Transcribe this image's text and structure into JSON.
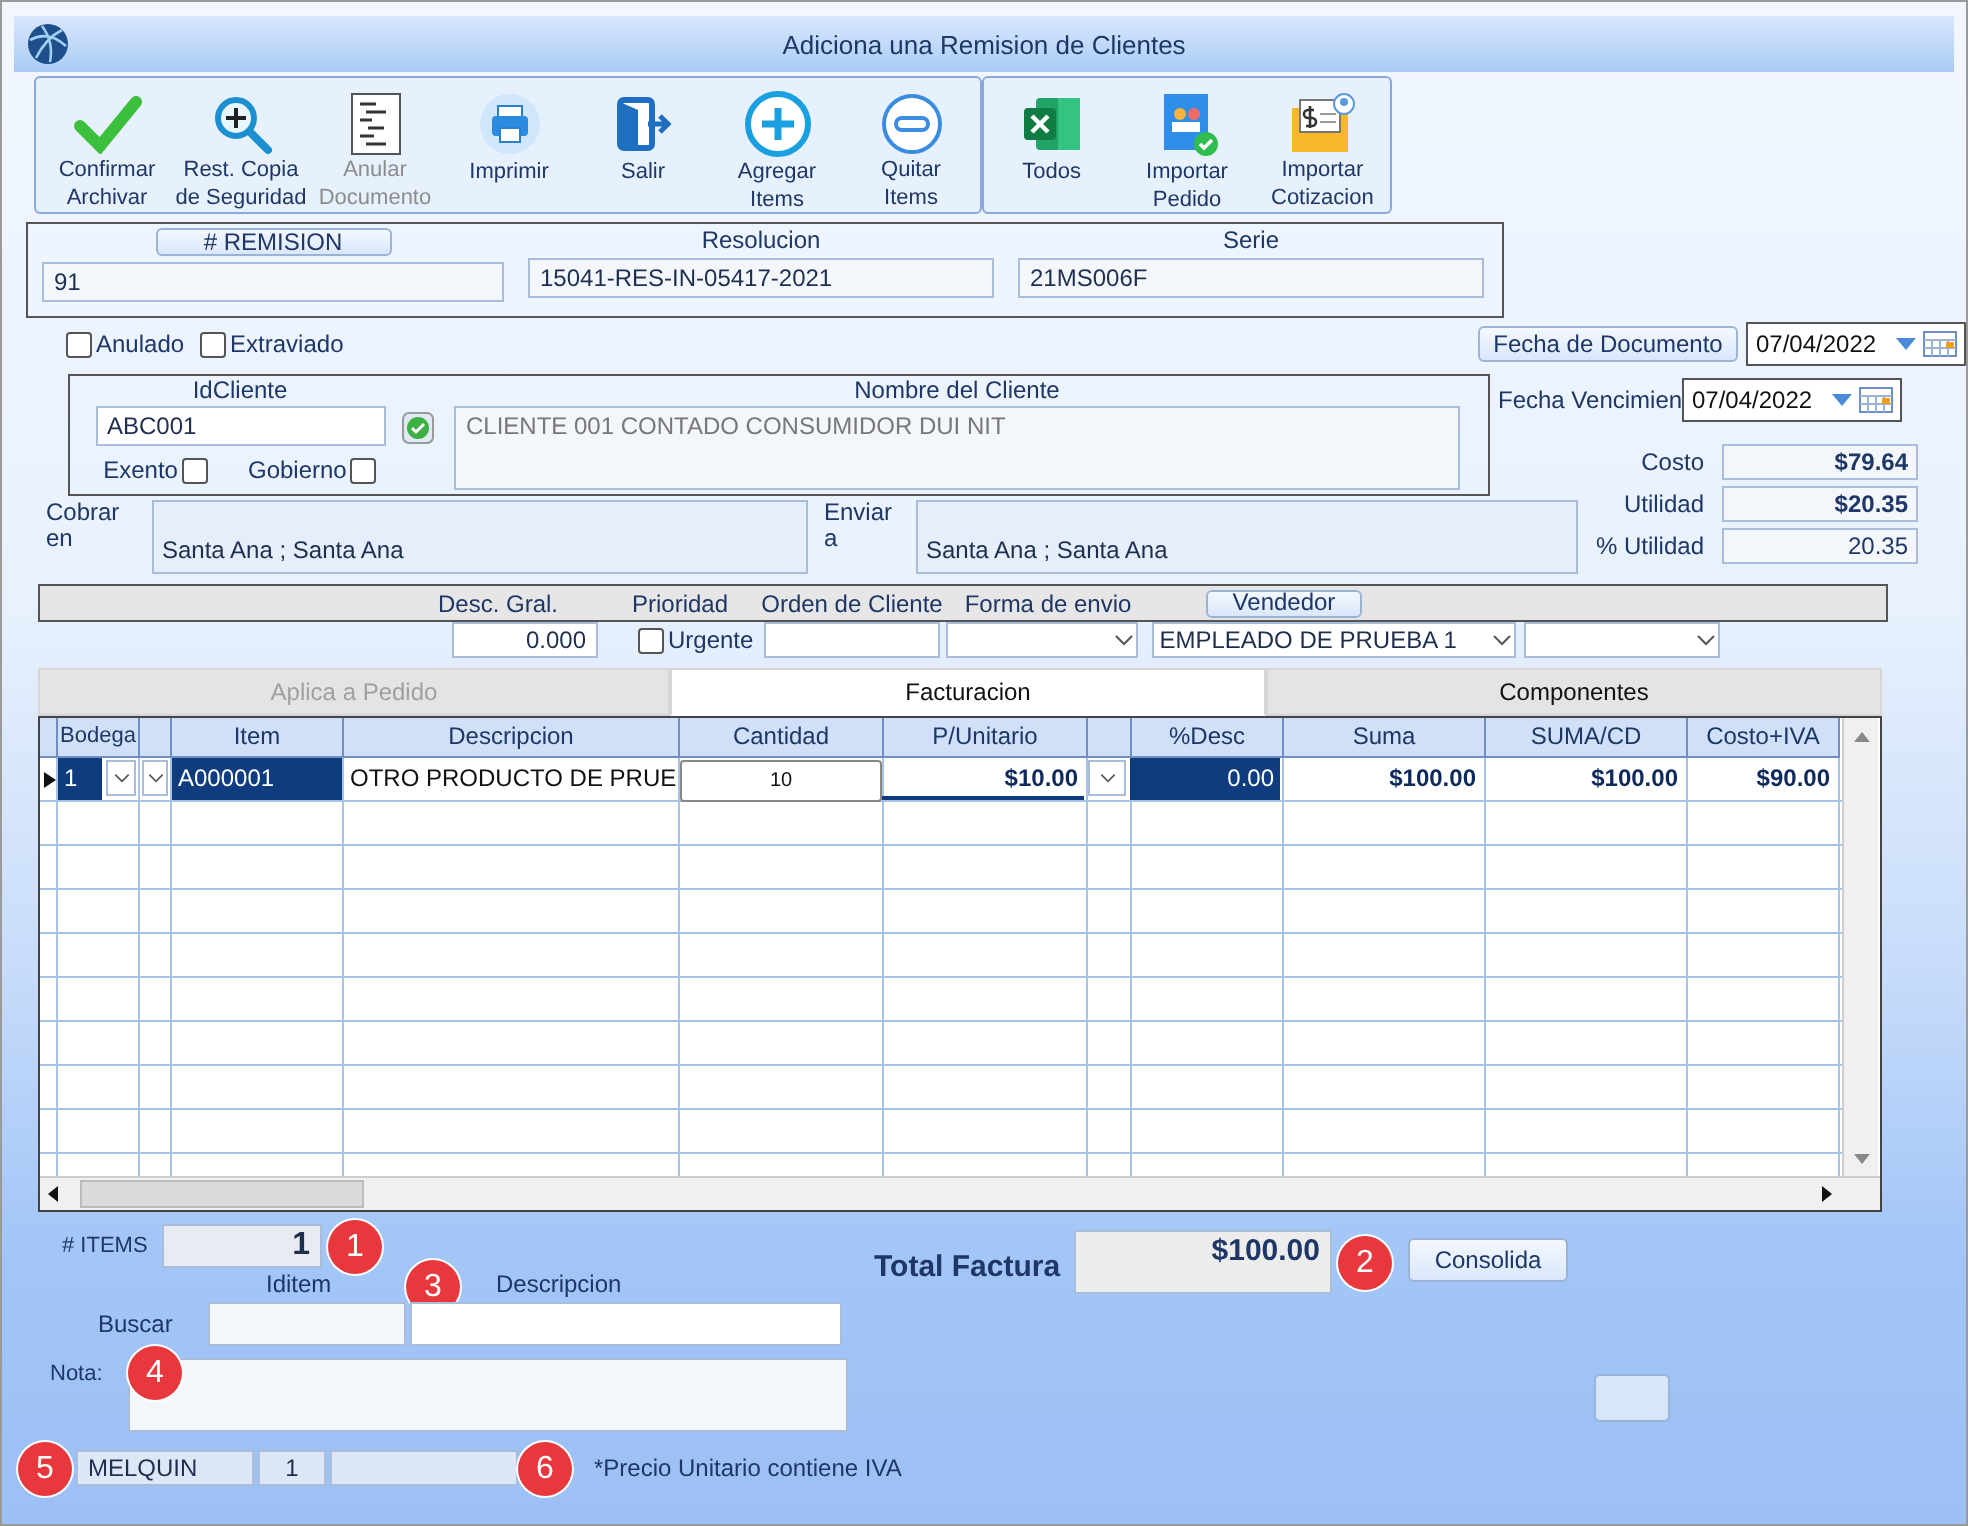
{
  "window": {
    "title": "Adiciona una Remision de Clientes"
  },
  "toolbar_groups": [
    {
      "buttons": [
        {
          "lines": [
            "Confirmar",
            "Archivar"
          ],
          "disabled": false
        },
        {
          "lines": [
            "Rest. Copia",
            "de Seguridad"
          ],
          "disabled": false
        },
        {
          "lines": [
            "Anular",
            "Documento"
          ],
          "disabled": true
        },
        {
          "lines": [
            "Imprimir"
          ],
          "disabled": false
        },
        {
          "lines": [
            "Salir"
          ],
          "disabled": false
        },
        {
          "lines": [
            "Agregar",
            "Items"
          ],
          "disabled": false
        },
        {
          "lines": [
            "Quitar",
            "Items"
          ],
          "disabled": false
        }
      ]
    },
    {
      "buttons": [
        {
          "lines": [
            "Todos"
          ],
          "disabled": false
        },
        {
          "lines": [
            "Importar",
            "Pedido"
          ],
          "disabled": false
        },
        {
          "lines": [
            "Importar",
            "Cotizacion"
          ],
          "disabled": false
        }
      ]
    }
  ],
  "header": [
    {
      "label": "# REMISION",
      "kind": "button",
      "value": "91"
    },
    {
      "label": "Resolucion",
      "kind": "label",
      "value": "15041-RES-IN-05417-2021"
    },
    {
      "label": "Serie",
      "kind": "label",
      "value": "21MS006F"
    }
  ],
  "flags": [
    {
      "label": "Anulado",
      "checked": false
    },
    {
      "label": "Extraviado",
      "checked": false
    }
  ],
  "fecha_documento": {
    "label": "Fecha de  Documento",
    "value": "07/04/2022"
  },
  "cliente": {
    "id_label": "IdCliente",
    "id_value": "ABC001",
    "name_label": "Nombre del Cliente",
    "name_value": "CLIENTE 001 CONTADO CONSUMIDOR DUI NIT",
    "options": [
      {
        "label": "Exento",
        "checked": false
      },
      {
        "label": "Gobierno",
        "checked": false
      }
    ]
  },
  "fecha_vencimiento": {
    "label": "Fecha Vencimien",
    "value": "07/04/2022"
  },
  "summary": [
    {
      "label": "Costo",
      "value": "$79.64",
      "bold": true
    },
    {
      "label": "Utilidad",
      "value": "$20.35",
      "bold": true
    },
    {
      "label": "% Utilidad",
      "value": "20.35",
      "bold": false
    }
  ],
  "addresses": [
    {
      "label_lines": [
        "Cobrar",
        "en"
      ],
      "value": "Santa Ana ; Santa Ana"
    },
    {
      "label_lines": [
        "Enviar",
        "a"
      ],
      "value": "Santa Ana ; Santa Ana"
    }
  ],
  "options_bar": {
    "desc_label": "Desc. Gral.",
    "prioridad_label": "Prioridad",
    "orden_label": "Orden de Cliente",
    "forma_label": "Forma de envio",
    "vendedor_button": "Vendedor",
    "desc_value": "0.000",
    "urgente": {
      "label": "Urgente",
      "checked": false
    },
    "vendedor_value": "EMPLEADO DE PRUEBA 1"
  },
  "tabs": [
    {
      "label": "Aplica a Pedido",
      "selected": false,
      "disabled": true
    },
    {
      "label": "Facturacion",
      "selected": true,
      "disabled": false
    },
    {
      "label": "Componentes",
      "selected": false,
      "disabled": false
    }
  ],
  "table": {
    "columns": [
      "Bodega",
      "Item",
      "Descripcion",
      "Cantidad",
      "P/Unitario",
      "%Desc",
      "Suma",
      "SUMA/CD",
      "Costo+IVA"
    ],
    "rows": [
      {
        "selected": true,
        "cells": [
          "1",
          "A000001",
          "OTRO PRODUCTO DE PRUE",
          "10",
          "$10.00",
          "0.00",
          "$100.00",
          "$100.00",
          "$90.00"
        ]
      }
    ]
  },
  "items_count": {
    "label": "# ITEMS",
    "value": "1"
  },
  "total": {
    "label": "Total Factura",
    "value": "$100.00"
  },
  "consolida_button": "Consolida",
  "buscar": {
    "label": "Buscar",
    "iditem_label": "Iditem",
    "descripcion_label": "Descripcion"
  },
  "nota": {
    "label": "Nota:"
  },
  "status": [
    "MELQUIN",
    "1"
  ],
  "footnote": "*Precio Unitario contiene IVA",
  "callouts": [
    "1",
    "2",
    "3",
    "4",
    "5",
    "6"
  ]
}
